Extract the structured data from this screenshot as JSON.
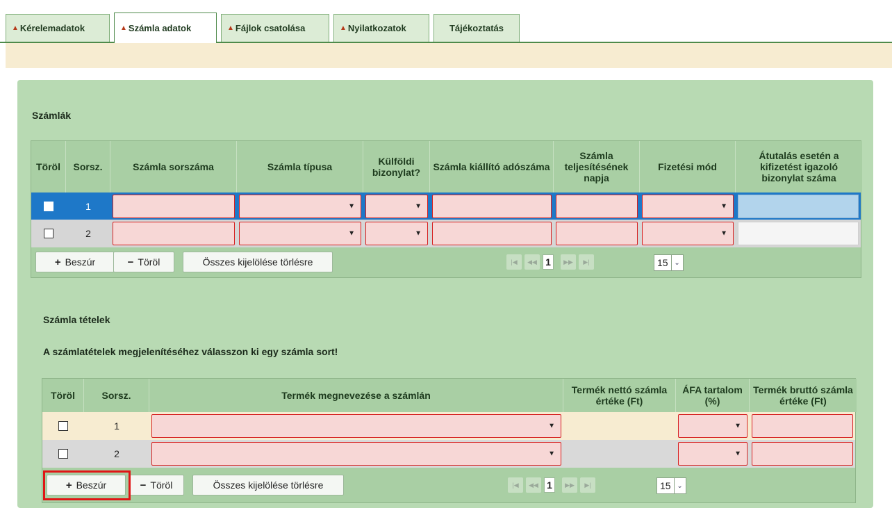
{
  "tabs": [
    {
      "label": "Kérelemadatok",
      "warn": true
    },
    {
      "label": "Számla adatok",
      "warn": true,
      "active": true
    },
    {
      "label": "Fájlok csatolása",
      "warn": true
    },
    {
      "label": "Nyilatkozatok",
      "warn": true
    },
    {
      "label": "Tájékoztatás",
      "warn": false
    }
  ],
  "warn_glyph": "▲",
  "invoices": {
    "title": "Számlák",
    "headers": [
      "Töröl",
      "Sorsz.",
      "Számla sorszáma",
      "Számla típusa",
      "Külföldi bizonylat?",
      "Számla kiállító adószáma",
      "Számla teljesítésének napja",
      "Fizetési mód",
      "Átutalás esetén a kifizetést igazoló bizonylat száma"
    ],
    "rows": [
      {
        "no": "1"
      },
      {
        "no": "2"
      }
    ],
    "buttons": {
      "insert": "Beszúr",
      "delete": "Töröl",
      "select_all": "Összes kijelölése törlésre",
      "insert_icon": "+",
      "delete_icon": "−"
    },
    "pager": {
      "page": "1",
      "page_size": "15"
    }
  },
  "items": {
    "title": "Számla tételek",
    "hint": "A számlatételek megjelenítéséhez válasszon ki egy számla sort!",
    "headers": [
      "Töröl",
      "Sorsz.",
      "Termék megnevezése a számlán",
      "Termék nettó számla értéke (Ft)",
      "ÁFA tartalom (%)",
      "Termék bruttó számla értéke (Ft)"
    ],
    "rows": [
      {
        "no": "1"
      },
      {
        "no": "2"
      }
    ],
    "buttons": {
      "insert": "Beszúr",
      "delete": "Töröl",
      "select_all": "Összes kijelölése törlésre",
      "insert_icon": "+",
      "delete_icon": "−"
    },
    "pager": {
      "page": "1",
      "page_size": "15"
    }
  },
  "icons": {
    "dropdown": "▼",
    "first": "|◀",
    "prev": "◀◀",
    "next": "▶▶",
    "last": "▶|",
    "size_dd": "⌄"
  },
  "colors": {
    "accent": "#4e8a4a",
    "panel": "#b8dab3",
    "invalid": "#d62020",
    "highlight": "#e01515",
    "selected_row": "#1e78c8"
  }
}
